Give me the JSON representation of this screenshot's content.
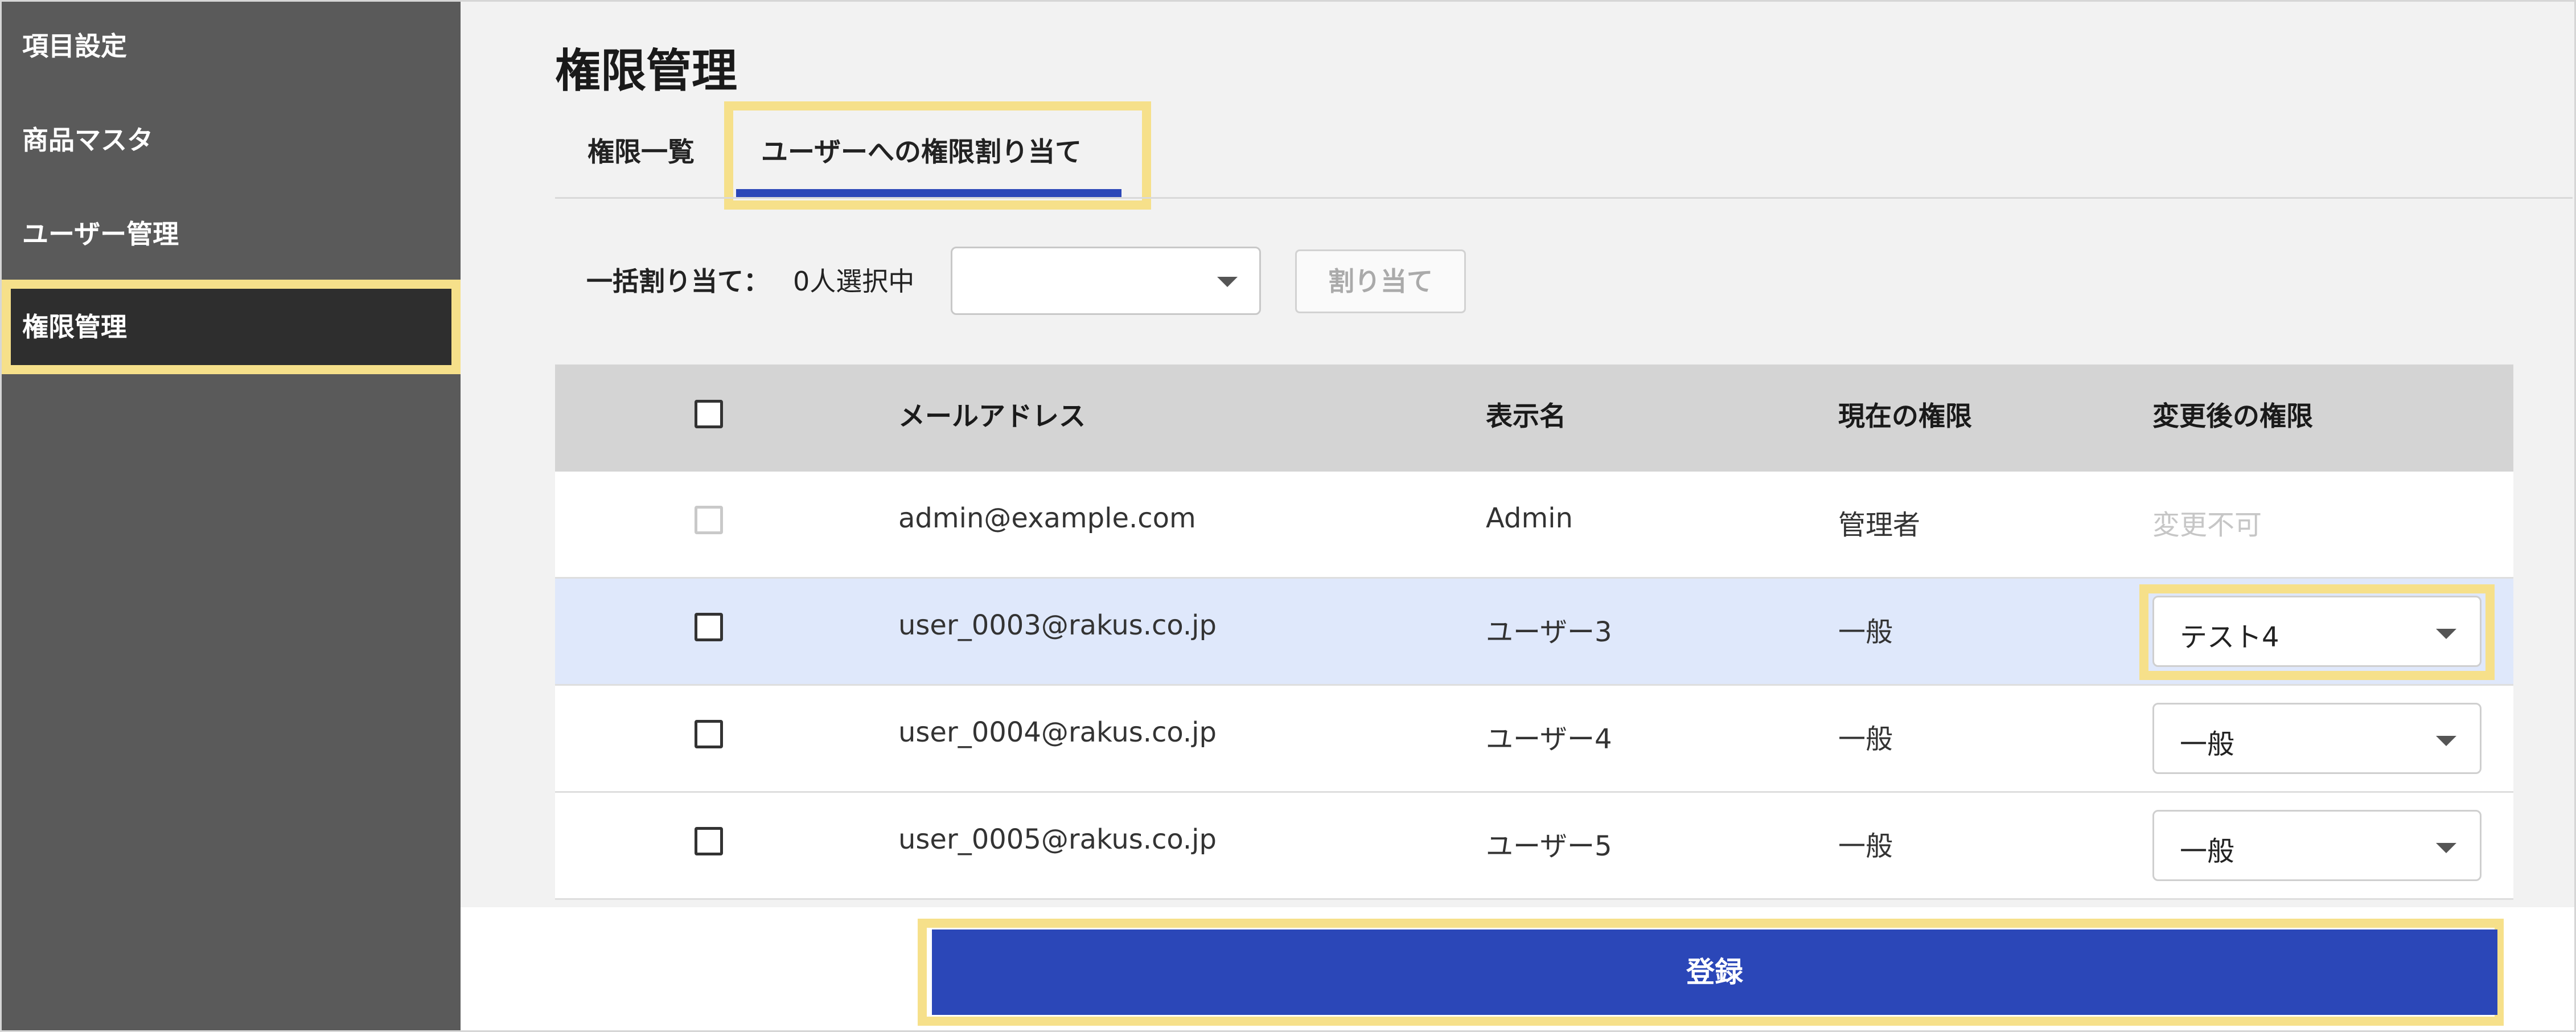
{
  "sidebar": {
    "items": [
      {
        "label": "項目設定"
      },
      {
        "label": "商品マスタ"
      },
      {
        "label": "ユーザー管理"
      },
      {
        "label": "権限管理",
        "active": true
      }
    ]
  },
  "page": {
    "title": "権限管理",
    "tabs": [
      {
        "label": "権限一覧"
      },
      {
        "label": "ユーザーへの権限割り当て",
        "active": true
      }
    ]
  },
  "bulk": {
    "label": "一括割り当て：",
    "count": "0人選択中",
    "select_value": "",
    "assign_label": "割り当て"
  },
  "table": {
    "headers": {
      "email": "メールアドレス",
      "name": "表示名",
      "current": "現在の権限",
      "new": "変更後の権限"
    },
    "rows": [
      {
        "email": "admin@example.com",
        "name": "Admin",
        "current": "管理者",
        "new": "変更不可",
        "editable": false
      },
      {
        "email": "user_0003@rakus.co.jp",
        "name": "ユーザー3",
        "current": "一般",
        "new": "テスト4",
        "editable": true
      },
      {
        "email": "user_0004@rakus.co.jp",
        "name": "ユーザー4",
        "current": "一般",
        "new": "一般",
        "editable": true
      },
      {
        "email": "user_0005@rakus.co.jp",
        "name": "ユーザー5",
        "current": "一般",
        "new": "一般",
        "editable": true
      }
    ]
  },
  "footer": {
    "register_label": "登録"
  },
  "colors": {
    "accent": "#2b47b8",
    "highlight": "#f6e08a",
    "sidebar": "#5a5a5a",
    "sidebar_active": "#2e2e2e",
    "selected_row": "#dfe8fb"
  },
  "icons": {
    "select_caret": "chevron-down-icon",
    "row_checkbox": "checkbox-icon"
  }
}
